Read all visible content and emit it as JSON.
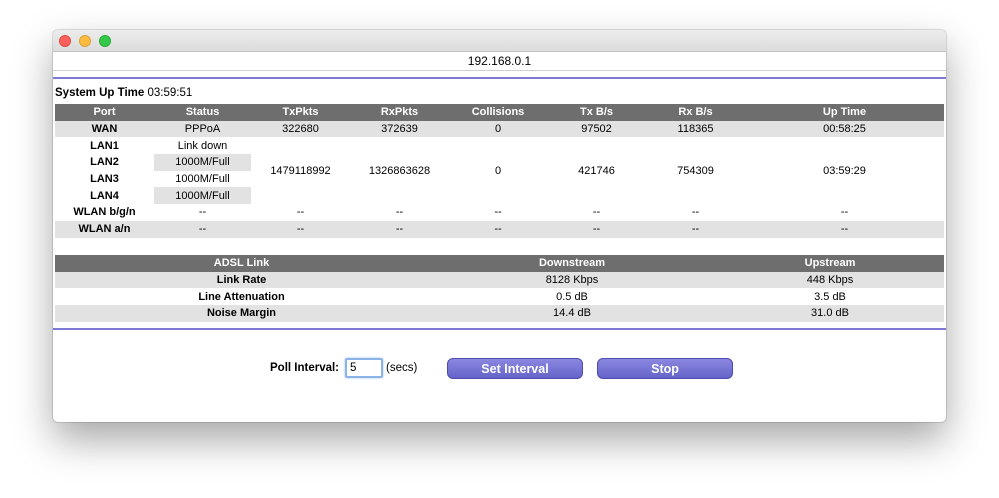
{
  "window": {
    "url": "192.168.0.1"
  },
  "uptime": {
    "label": "System Up Time",
    "value": "03:59:51"
  },
  "stats": {
    "headers": [
      "Port",
      "Status",
      "TxPkts",
      "RxPkts",
      "Collisions",
      "Tx B/s",
      "Rx B/s",
      "Up Time"
    ],
    "wan": {
      "port": "WAN",
      "status": "PPPoA",
      "txpkts": "322680",
      "rxpkts": "372639",
      "collisions": "0",
      "txbs": "97502",
      "rxbs": "118365",
      "uptime": "00:58:25"
    },
    "lan": {
      "ports": [
        {
          "port": "LAN1",
          "status": "Link down"
        },
        {
          "port": "LAN2",
          "status": "1000M/Full"
        },
        {
          "port": "LAN3",
          "status": "1000M/Full"
        },
        {
          "port": "LAN4",
          "status": "1000M/Full"
        }
      ],
      "txpkts": "1479118992",
      "rxpkts": "1326863628",
      "collisions": "0",
      "txbs": "421746",
      "rxbs": "754309",
      "uptime": "03:59:29"
    },
    "wlan_bgn": {
      "port": "WLAN b/g/n",
      "status": "--",
      "txpkts": "--",
      "rxpkts": "--",
      "collisions": "--",
      "txbs": "--",
      "rxbs": "--",
      "uptime": "--"
    },
    "wlan_an": {
      "port": "WLAN a/n",
      "status": "--",
      "txpkts": "--",
      "rxpkts": "--",
      "collisions": "--",
      "txbs": "--",
      "rxbs": "--",
      "uptime": "--"
    }
  },
  "adsl": {
    "headers": [
      "ADSL Link",
      "Downstream",
      "Upstream"
    ],
    "rows": [
      {
        "label": "Link Rate",
        "down": "8128 Kbps",
        "up": "448 Kbps"
      },
      {
        "label": "Line Attenuation",
        "down": "0.5 dB",
        "up": "3.5 dB"
      },
      {
        "label": "Noise Margin",
        "down": "14.4 dB",
        "up": "31.0 dB"
      }
    ]
  },
  "controls": {
    "poll_label": "Poll Interval:",
    "poll_value": "5",
    "secs_label": "(secs)",
    "set_label": "Set Interval",
    "stop_label": "Stop"
  },
  "colors": {
    "accent": "#7d7ad6",
    "button": "#6663c9",
    "header": "#6e6e6e",
    "row_alt": "#e2e2e2"
  }
}
